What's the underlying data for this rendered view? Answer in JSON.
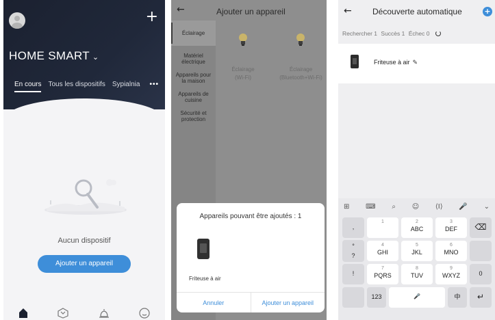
{
  "panel1": {
    "plus_icon": "+",
    "home_title": "HOME SMART",
    "chevron": "⌄",
    "tabs": [
      "En cours",
      "Tous les dispositifs",
      "Sypialnia"
    ],
    "more": "•••",
    "empty_text": "Aucun dispositif",
    "add_button": "Ajouter un appareil",
    "nav_icons": [
      "home-icon",
      "scene-icon",
      "notification-bell-icon",
      "profile-icon"
    ]
  },
  "panel2": {
    "back_icon": "←",
    "title": "Ajouter un appareil",
    "categories": [
      "Éclairage",
      "Matériel électrique",
      "Appareils pour la maison",
      "Appareils de cuisine",
      "Sécurité et protection"
    ],
    "devices": [
      {
        "name": "Éclairage",
        "sub": "(Wi-Fi)"
      },
      {
        "name": "Éclairage",
        "sub": "(Bluetooth+Wi-Fi)"
      }
    ],
    "sheet": {
      "title": "Appareils pouvant être ajoutés : 1",
      "device_name": "Friteuse à air",
      "cancel": "Annuler",
      "confirm": "Ajouter un appareil"
    }
  },
  "panel3": {
    "back_icon": "←",
    "title": "Découverte automatique",
    "help": "+",
    "stats": {
      "search": "Rechercher 1",
      "success": "Succès 1",
      "fail": "Échec 0"
    },
    "device_name": "Friteuse à air",
    "edit_icon": "✎",
    "keyboard": {
      "toolbar": [
        "⊞",
        "⌨",
        "⌕",
        "☺",
        "⟨I⟩",
        "🎤",
        "⌄"
      ],
      "row1": [
        {
          "num": "1",
          "let": ""
        },
        {
          "num": "2",
          "let": "ABC"
        },
        {
          "num": "3",
          "let": "DEF"
        }
      ],
      "row2": [
        {
          "num": "4",
          "let": "GHI"
        },
        {
          "num": "5",
          "let": "JKL"
        },
        {
          "num": "6",
          "let": "MNO"
        }
      ],
      "row3": [
        {
          "num": "7",
          "let": "PQRS"
        },
        {
          "num": "8",
          "let": "TUV"
        },
        {
          "num": "9",
          "let": "WXYZ"
        }
      ],
      "left_keys": [
        ",",
        "°",
        "?",
        "!"
      ],
      "backspace": "⌫",
      "zero": "0",
      "num_key": "123",
      "space_mic": "🎤",
      "lang_key": "中",
      "enter": "↵"
    }
  },
  "colors": {
    "accent": "#3e8ed9",
    "header_dark": "#1b2130"
  }
}
